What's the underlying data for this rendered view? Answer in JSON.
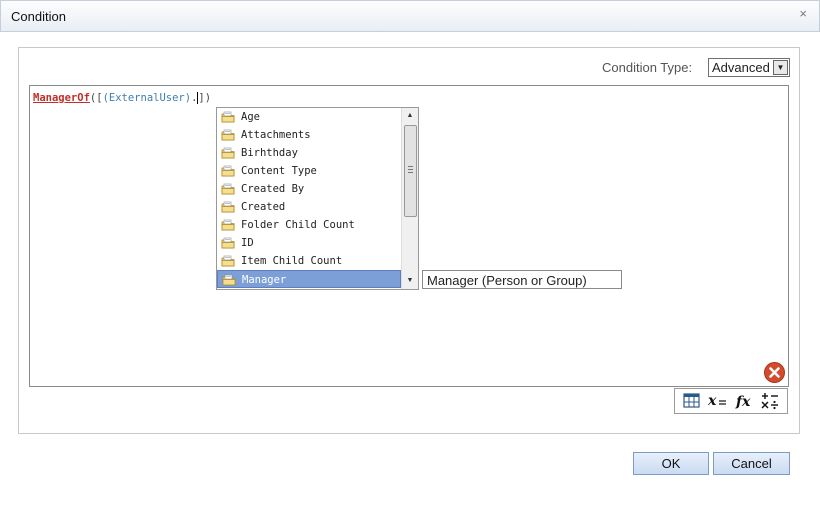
{
  "dialog": {
    "title": "Condition",
    "close_label": "×"
  },
  "condition_type": {
    "label": "Condition Type:",
    "selected": "Advanced"
  },
  "expression": {
    "function": "ManagerOf",
    "open": "([",
    "field": "(ExternalUser)",
    "dot": ".",
    "close": "])"
  },
  "autocomplete": {
    "items": [
      {
        "label": "Age"
      },
      {
        "label": "Attachments"
      },
      {
        "label": "Birhthday"
      },
      {
        "label": "Content Type"
      },
      {
        "label": "Created By"
      },
      {
        "label": "Created"
      },
      {
        "label": "Folder Child Count"
      },
      {
        "label": "ID"
      },
      {
        "label": "Item Child Count"
      },
      {
        "label": "Manager",
        "selected": true
      }
    ],
    "tooltip": "Manager (Person or Group)"
  },
  "toolbar": {
    "icons": [
      "table-icon",
      "variable-icon",
      "function-icon",
      "operators-icon"
    ]
  },
  "buttons": {
    "ok": "OK",
    "cancel": "Cancel"
  },
  "colors": {
    "accent": "#7c9fd8",
    "function": "#c0302a",
    "identifier": "#3d7fb0",
    "delete": "#d34b2c"
  }
}
